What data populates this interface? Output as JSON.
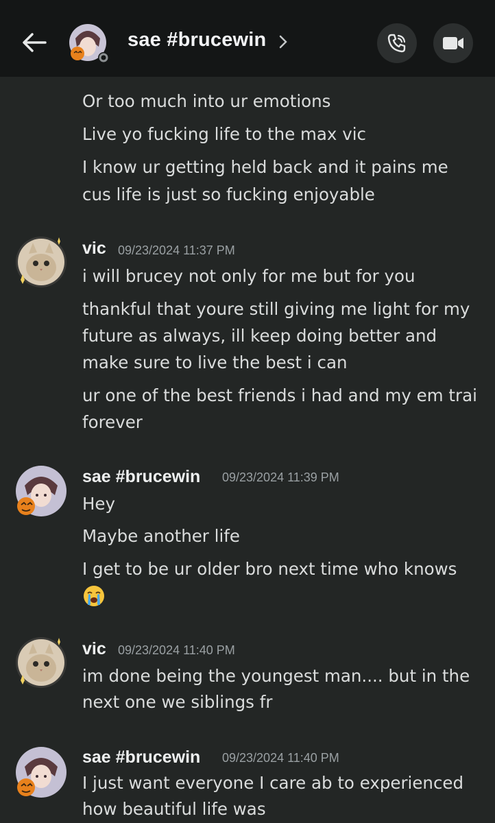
{
  "header": {
    "title": "sae #brucewin"
  },
  "colors": {
    "background": "#232625",
    "header": "#141616",
    "text": "#dadcdc",
    "timestamp": "#9aa0a3"
  },
  "groups": [
    {
      "lines": [
        "Or too much into ur emotions",
        "Live yo fucking life to the max vic",
        "I know ur getting held back and it pains me",
        "cus life is just so fucking enjoyable"
      ]
    },
    {
      "author": "vic",
      "time": "09/23/2024 11:37 PM",
      "lines": [
        "i will brucey not only for me but for you",
        "thankful that youre still giving me light for my",
        "future as always, ill keep doing better and",
        "make sure to live the best i can",
        "ur one of the best friends i had and my em trai",
        "forever"
      ]
    },
    {
      "author": "sae #brucewin",
      "time": "09/23/2024 11:39 PM",
      "lines": [
        "Hey",
        "Maybe another life",
        "I get to be ur older bro next time who knows"
      ]
    },
    {
      "author": "vic",
      "time": "09/23/2024 11:40 PM",
      "lines": [
        "im done being the youngest man.... but in the",
        "next one we siblings fr"
      ]
    },
    {
      "author": "sae #brucewin",
      "time": "09/23/2024 11:40 PM",
      "lines": [
        "I just want everyone I care ab to experienced",
        "how beautiful life was"
      ]
    }
  ]
}
